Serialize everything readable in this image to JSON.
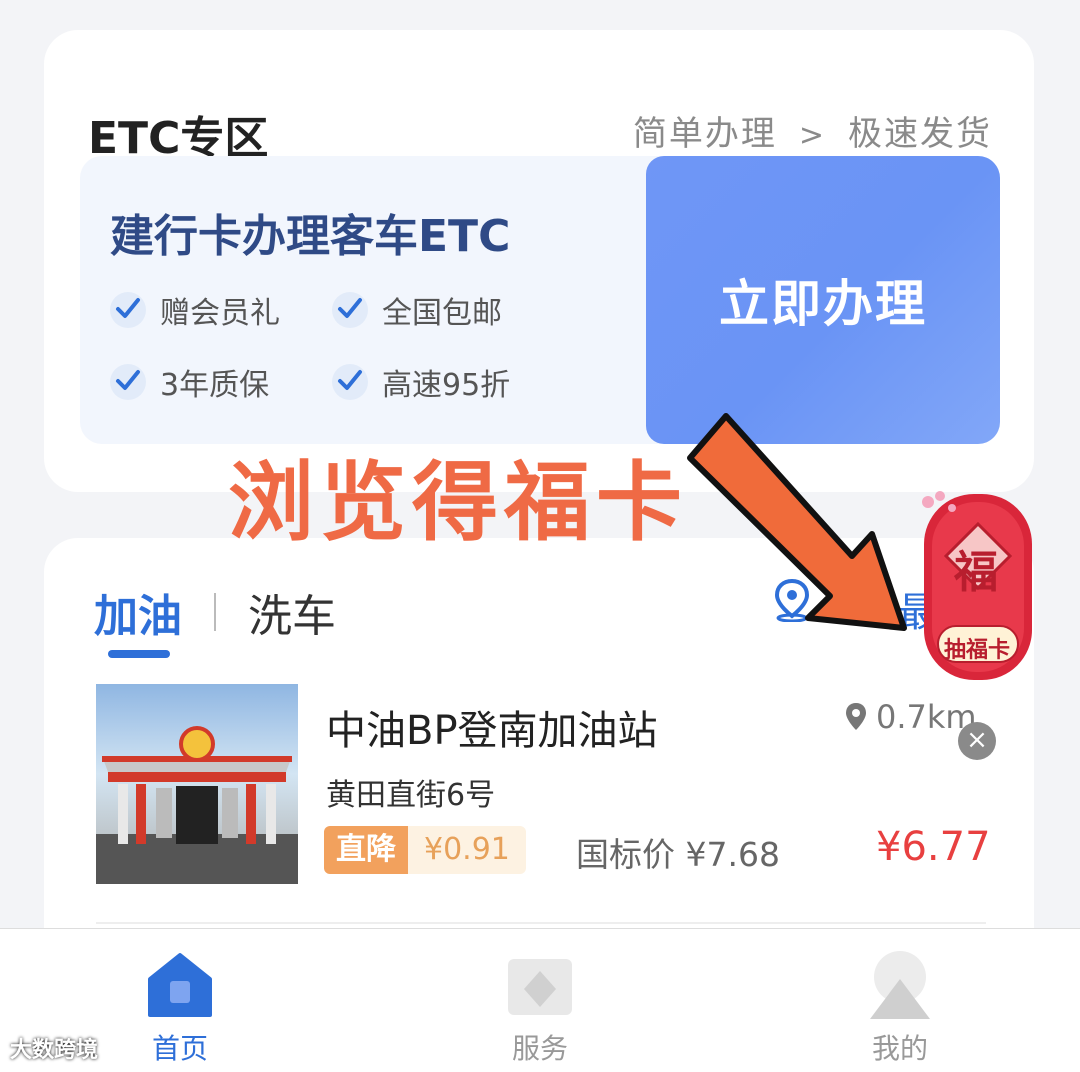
{
  "etc": {
    "title": "ETC专区",
    "sub_step1": "简单办理",
    "sub_sep": ">",
    "sub_step2": "极速发货",
    "promo_title": "建行卡办理客车ETC",
    "features": [
      "赠会员礼",
      "全国包邮",
      "3年质保",
      "高速95折"
    ],
    "apply_label": "立即办理"
  },
  "overlay": {
    "caption": "浏览得福卡"
  },
  "fu_widget": {
    "char": "福",
    "label": "抽福卡",
    "close": "×"
  },
  "fuel": {
    "tab_fuel": "加油",
    "tab_wash": "洗车",
    "partial_sort": "最",
    "station": {
      "name": "中油BP登南加油站",
      "address": "黄田直街6号",
      "distance": "0.7km",
      "badge_label": "直降",
      "badge_value": "¥0.91",
      "standard_price": "国标价 ¥7.68",
      "price": "¥6.77"
    }
  },
  "nav": {
    "home": "首页",
    "service": "服务",
    "mine": "我的"
  },
  "watermark": "大数跨境",
  "colors": {
    "accent": "#2e6fd8",
    "apply_button": "#6f96f6",
    "price_red": "#e84040",
    "overlay_orange": "#ef6a45"
  }
}
